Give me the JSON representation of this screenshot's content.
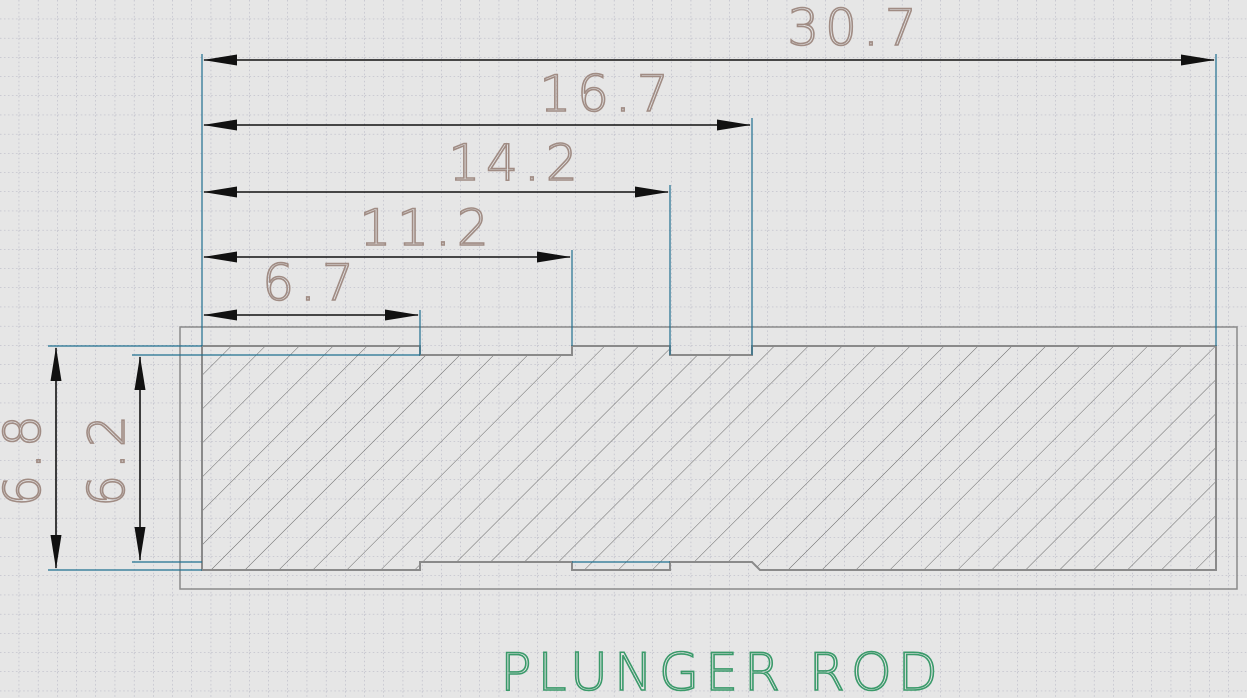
{
  "drawing": {
    "title": "PLUNGER ROD",
    "dimensions": {
      "overall_length": "30.7",
      "step_16_7": "16.7",
      "step_14_2": "14.2",
      "step_11_2": "11.2",
      "step_6_7": "6.7",
      "outer_diameter": "6.8",
      "groove_diameter": "6.2"
    }
  },
  "colors": {
    "background": "#e6e6e6",
    "grid": "#9a9ab0",
    "outline": "#8a8a8a",
    "hatch": "#6a6a6a",
    "extension_line": "#1f6f8f",
    "dimension_line": "#111111",
    "dimension_text": "#a08c84",
    "title_text": "#3a9a6a"
  }
}
